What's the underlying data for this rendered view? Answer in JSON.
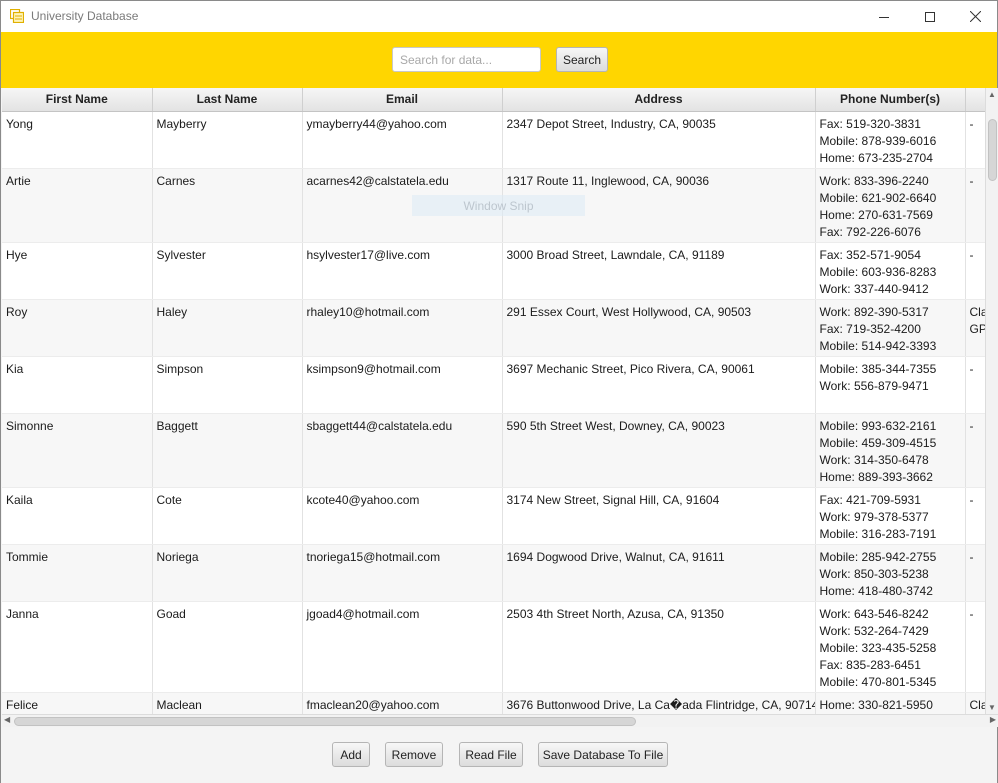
{
  "window": {
    "title": "University Database"
  },
  "toolbar": {
    "search_placeholder": "Search for data...",
    "search_label": "Search"
  },
  "overlay": {
    "text": "Window Snip"
  },
  "table": {
    "columns": [
      "First Name",
      "Last Name",
      "Email",
      "Address",
      "Phone Number(s)",
      ""
    ],
    "rows": [
      {
        "first": "Yong",
        "last": "Mayberry",
        "email": "ymayberry44@yahoo.com",
        "address": "2347 Depot Street, Industry, CA, 90035",
        "phones": [
          "Fax: 519-320-3831",
          "Mobile: 878-939-6016",
          "Home: 673-235-2704"
        ],
        "extra": [
          "-"
        ]
      },
      {
        "first": "Artie",
        "last": "Carnes",
        "email": "acarnes42@calstatela.edu",
        "address": "1317 Route 11, Inglewood, CA, 90036",
        "phones": [
          "Work: 833-396-2240",
          "Mobile: 621-902-6640",
          "Home: 270-631-7569",
          "Fax: 792-226-6076"
        ],
        "extra": [
          "-"
        ]
      },
      {
        "first": "Hye",
        "last": "Sylvester",
        "email": "hsylvester17@live.com",
        "address": "3000 Broad Street, Lawndale, CA, 91189",
        "phones": [
          "Fax: 352-571-9054",
          "Mobile: 603-936-8283",
          "Work: 337-440-9412"
        ],
        "extra": [
          "-"
        ]
      },
      {
        "first": "Roy",
        "last": "Haley",
        "email": "rhaley10@hotmail.com",
        "address": "291 Essex Court, West Hollywood, CA, 90503",
        "phones": [
          "Work: 892-390-5317",
          "Fax: 719-352-4200",
          "Mobile: 514-942-3393"
        ],
        "extra": [
          "Cla",
          "GP"
        ]
      },
      {
        "first": "Kia",
        "last": "Simpson",
        "email": "ksimpson9@hotmail.com",
        "address": "3697 Mechanic Street, Pico Rivera, CA, 90061",
        "phones": [
          "Mobile: 385-344-7355",
          "Work: 556-879-9471"
        ],
        "extra": [
          "-"
        ]
      },
      {
        "first": "Simonne",
        "last": "Baggett",
        "email": "sbaggett44@calstatela.edu",
        "address": "590 5th Street West, Downey, CA, 90023",
        "phones": [
          "Mobile: 993-632-2161",
          "Mobile: 459-309-4515",
          "Work: 314-350-6478",
          "Home: 889-393-3662"
        ],
        "extra": [
          "-"
        ]
      },
      {
        "first": "Kaila",
        "last": "Cote",
        "email": "kcote40@yahoo.com",
        "address": "3174 New Street, Signal Hill, CA, 91604",
        "phones": [
          "Fax: 421-709-5931",
          "Work: 979-378-5377",
          "Mobile: 316-283-7191"
        ],
        "extra": [
          "-"
        ]
      },
      {
        "first": "Tommie",
        "last": "Noriega",
        "email": "tnoriega15@hotmail.com",
        "address": "1694 Dogwood Drive, Walnut, CA, 91611",
        "phones": [
          "Mobile: 285-942-2755",
          "Work: 850-303-5238",
          "Home: 418-480-3742"
        ],
        "extra": [
          "-"
        ]
      },
      {
        "first": "Janna",
        "last": "Goad",
        "email": "jgoad4@hotmail.com",
        "address": "2503 4th Street North, Azusa, CA, 91350",
        "phones": [
          "Work: 643-546-8242",
          "Work: 532-264-7429",
          "Mobile: 323-435-5258",
          "Fax: 835-283-6451",
          "Mobile: 470-801-5345"
        ],
        "extra": [
          "-"
        ]
      },
      {
        "first": "Felice",
        "last": "Maclean",
        "email": "fmaclean20@yahoo.com",
        "address": "3676 Buttonwood Drive, La Ca�ada Flintridge, CA, 90714",
        "phones": [
          "Home: 330-821-5950"
        ],
        "extra": [
          "Cla"
        ]
      }
    ]
  },
  "bottom": {
    "add_label": "Add",
    "remove_label": "Remove",
    "read_label": "Read File",
    "save_label": "Save Database To File"
  },
  "colors": {
    "toolbar_bg": "#ffd600",
    "app_icon": "#e8b800"
  }
}
